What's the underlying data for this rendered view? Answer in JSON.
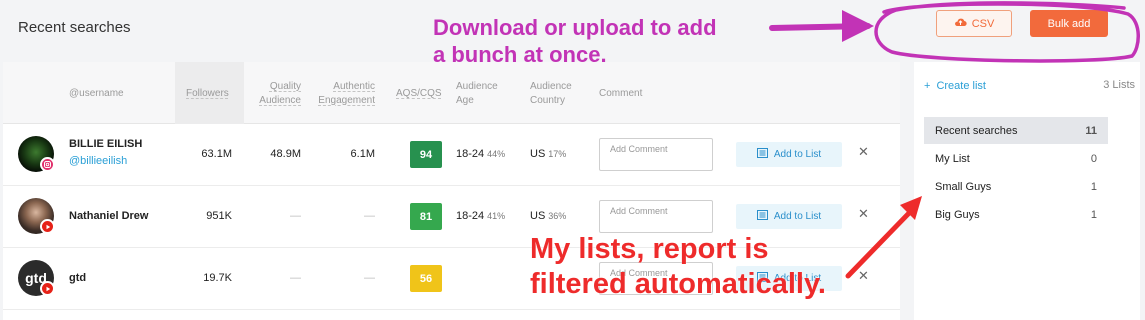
{
  "header": {
    "title": "Recent searches",
    "csv_label": "CSV",
    "bulk_label": "Bulk add"
  },
  "table": {
    "columns": {
      "username": "@username",
      "followers": "Followers",
      "quality_1": "Quality",
      "quality_2": "Audience",
      "authentic_1": "Authentic",
      "authentic_2": "Engagement",
      "aqs": "AQS/CQS",
      "age_1": "Audience",
      "age_2": "Age",
      "country_1": "Audience",
      "country_2": "Country",
      "comment": "Comment"
    },
    "rows": [
      {
        "name": "BILLIE EILISH",
        "handle": "@billieeilish",
        "followers": "63.1M",
        "quality": "48.9M",
        "authentic": "6.1M",
        "score": "94",
        "score_color": "#27914f",
        "age": "18-24",
        "age_pct": "44%",
        "country": "US",
        "country_pct": "17%",
        "platform": "instagram"
      },
      {
        "name": "Nathaniel Drew",
        "handle": "",
        "followers": "951K",
        "quality": "—",
        "authentic": "—",
        "score": "81",
        "score_color": "#35a84e",
        "age": "18-24",
        "age_pct": "41%",
        "country": "US",
        "country_pct": "36%",
        "platform": "youtube"
      },
      {
        "name": "gtd",
        "handle": "",
        "followers": "19.7K",
        "quality": "—",
        "authentic": "—",
        "score": "56",
        "score_color": "#f0c419",
        "age": "",
        "age_pct": "",
        "country": "",
        "country_pct": "",
        "platform": "youtube"
      }
    ],
    "comment_placeholder": "Add Comment",
    "add_to_list_label": "Add to List",
    "remove_glyph": "✕"
  },
  "lists_panel": {
    "create_label": "Create list",
    "count": "3 Lists",
    "items": [
      {
        "label": "Recent searches",
        "count": "11"
      },
      {
        "label": "My List",
        "count": "0"
      },
      {
        "label": "Small Guys",
        "count": "1"
      },
      {
        "label": "Big Guys",
        "count": "1"
      }
    ]
  },
  "annotations": {
    "purple_1": "Download or upload to add",
    "purple_2": "a bunch at once.",
    "red_1": "My lists, report is",
    "red_2": "filtered automatically."
  },
  "colors": {
    "accent_orange": "#f26a3c",
    "link_blue": "#2a9fd6",
    "annotation_purple": "#c233b6",
    "annotation_red": "#ee2b2b"
  }
}
